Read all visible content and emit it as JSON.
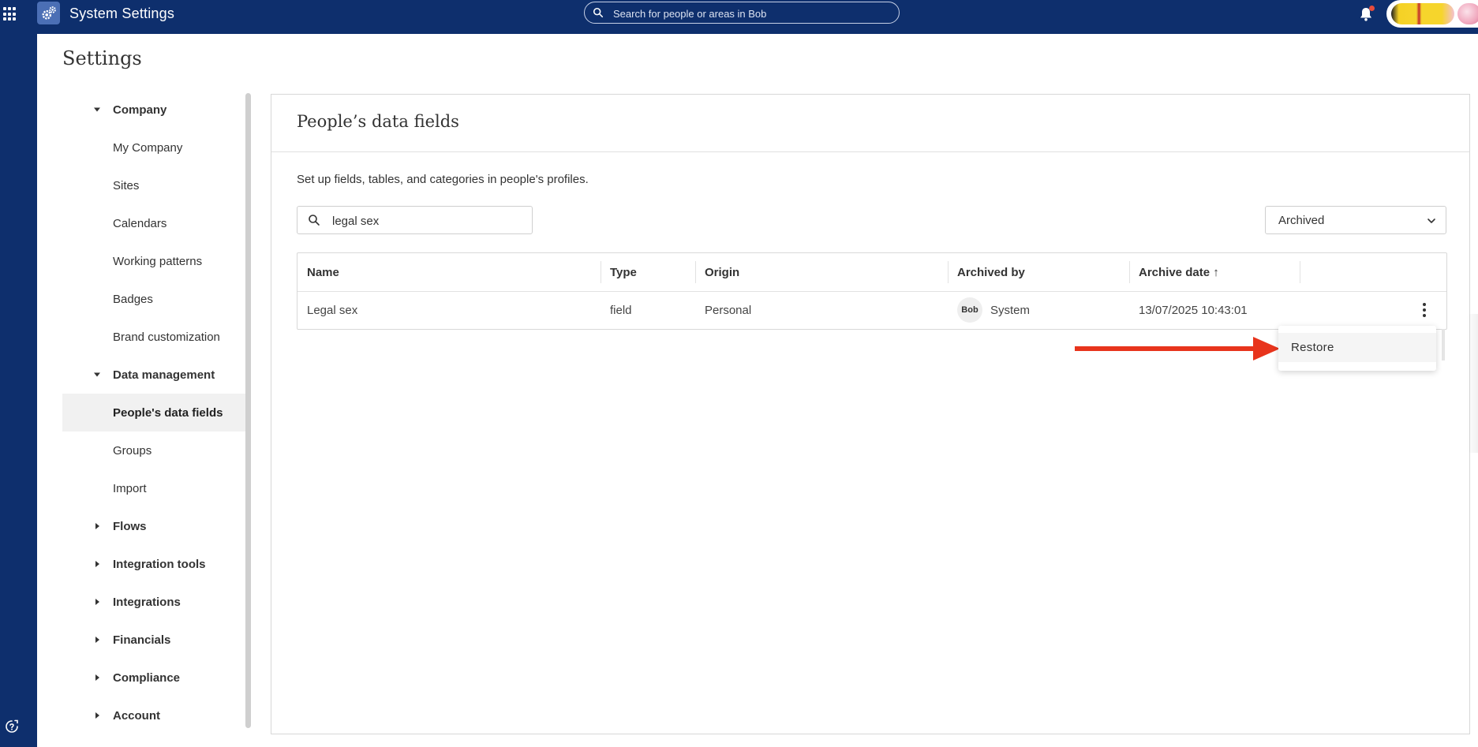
{
  "header": {
    "app_title": "System Settings",
    "search_placeholder": "Search for people or areas in Bob"
  },
  "page": {
    "title": "Settings"
  },
  "nav": {
    "items": [
      {
        "label": "Company",
        "type": "group",
        "expanded": true
      },
      {
        "label": "My Company",
        "type": "child"
      },
      {
        "label": "Sites",
        "type": "child"
      },
      {
        "label": "Calendars",
        "type": "child"
      },
      {
        "label": "Working patterns",
        "type": "child"
      },
      {
        "label": "Badges",
        "type": "child"
      },
      {
        "label": "Brand customization",
        "type": "child"
      },
      {
        "label": "Data management",
        "type": "group",
        "expanded": true
      },
      {
        "label": "People's data fields",
        "type": "child",
        "active": true
      },
      {
        "label": "Groups",
        "type": "child"
      },
      {
        "label": "Import",
        "type": "child"
      },
      {
        "label": "Flows",
        "type": "group",
        "expanded": false
      },
      {
        "label": "Integration tools",
        "type": "group",
        "expanded": false
      },
      {
        "label": "Integrations",
        "type": "group",
        "expanded": false
      },
      {
        "label": "Financials",
        "type": "group",
        "expanded": false
      },
      {
        "label": "Compliance",
        "type": "group",
        "expanded": false
      },
      {
        "label": "Account",
        "type": "group",
        "expanded": false
      }
    ]
  },
  "panel": {
    "title": "People’s data fields",
    "description": "Set up fields, tables, and categories in people's profiles.",
    "search_value": "legal sex",
    "filter_value": "Archived"
  },
  "table": {
    "columns": [
      "Name",
      "Type",
      "Origin",
      "Archived by",
      "Archive date ↑"
    ],
    "rows": [
      {
        "name": "Legal sex",
        "type": "field",
        "origin": "Personal",
        "archived_by_badge": "Bob",
        "archived_by": "System",
        "archive_date": "13/07/2025 10:43:01"
      }
    ]
  },
  "menu": {
    "restore_label": "Restore"
  },
  "colors": {
    "header_bg": "#0e2f6d",
    "arrow": "#e8341c",
    "active_nav_bg": "#f1f1f1"
  }
}
